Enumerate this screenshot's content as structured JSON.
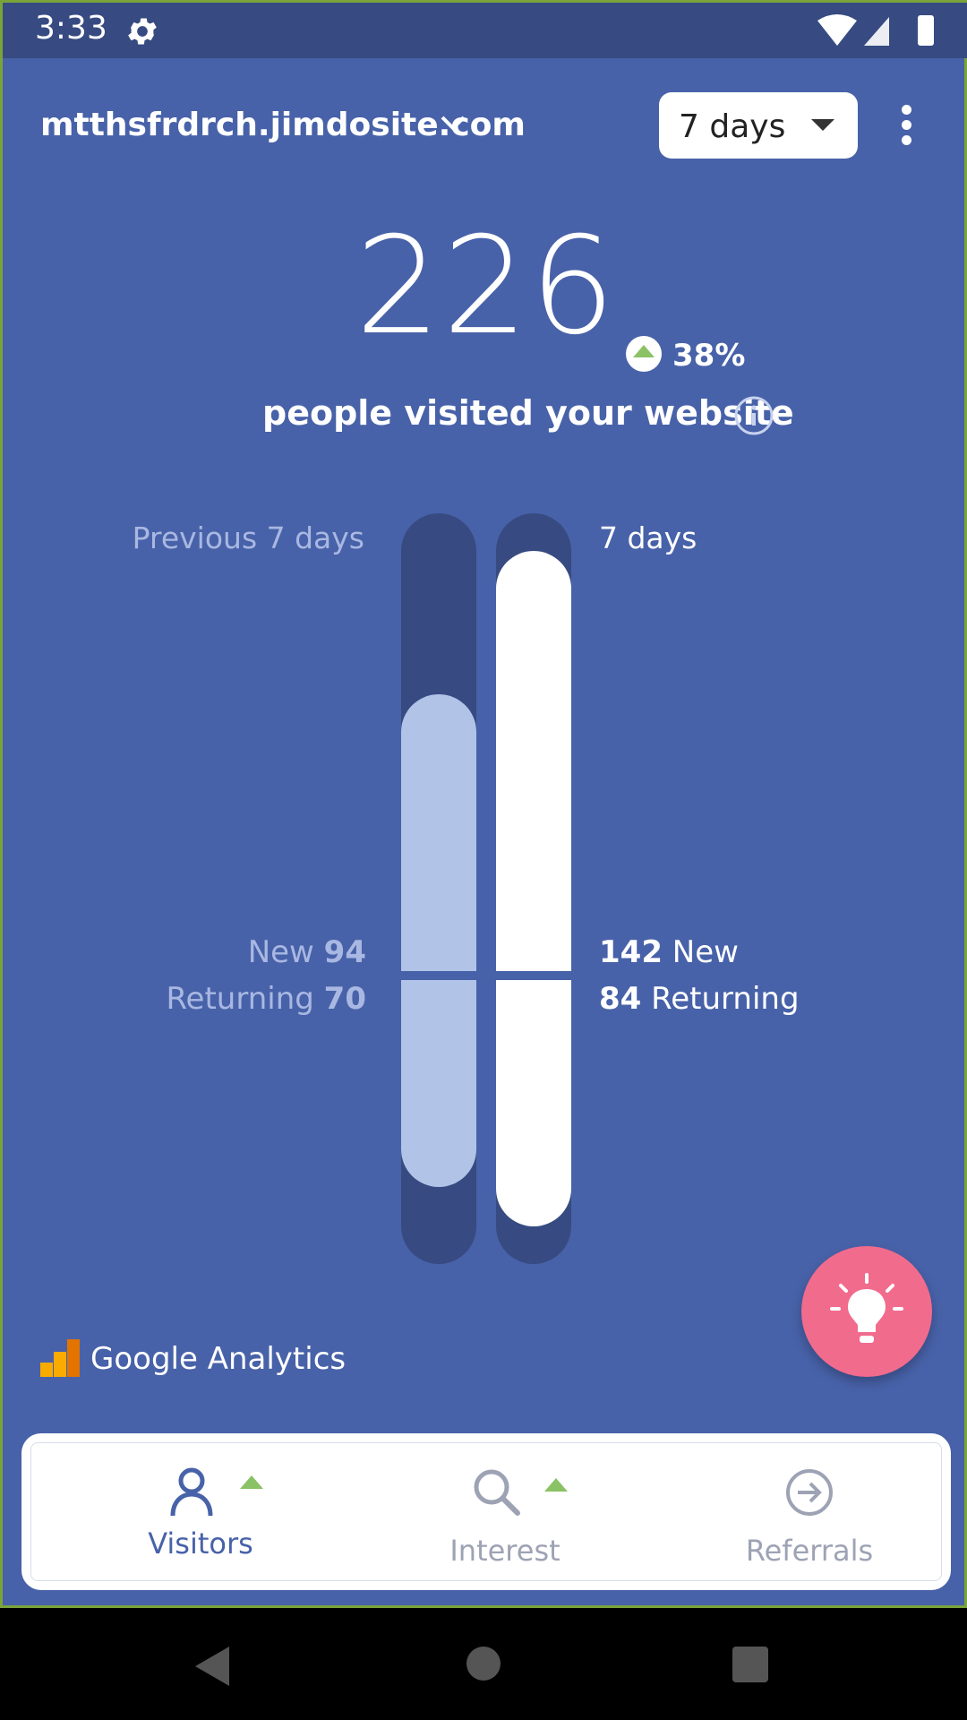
{
  "status": {
    "time": "3:33"
  },
  "header": {
    "site": "mtthsfrdrch.jimdosite.com",
    "period": "7 days"
  },
  "summary": {
    "total": "226",
    "change": "38%",
    "headline": "people visited your website"
  },
  "comparison": {
    "previous_label": "Previous 7 days",
    "current_label": "7 days",
    "previous": {
      "new_label": "New",
      "new_value": "94",
      "returning_label": "Returning",
      "returning_value": "70"
    },
    "current": {
      "new_label": "New",
      "new_value": "142",
      "returning_label": "Returning",
      "returning_value": "84"
    }
  },
  "brand": {
    "analytics": "Google Analytics"
  },
  "tabs": [
    {
      "label": "Visitors",
      "active": true
    },
    {
      "label": "Interest",
      "active": false
    },
    {
      "label": "Referrals",
      "active": false
    }
  ],
  "colors": {
    "background": "#4862a9",
    "accent_up": "#8ac265",
    "fab": "#f16b8d"
  },
  "icons": [
    "gear-icon",
    "wifi-icon",
    "signal-icon",
    "battery-icon",
    "chevron-down-icon",
    "more-vert-icon",
    "info-icon",
    "lightbulb-icon",
    "person-icon",
    "search-icon",
    "arrow-circle-right-icon"
  ]
}
